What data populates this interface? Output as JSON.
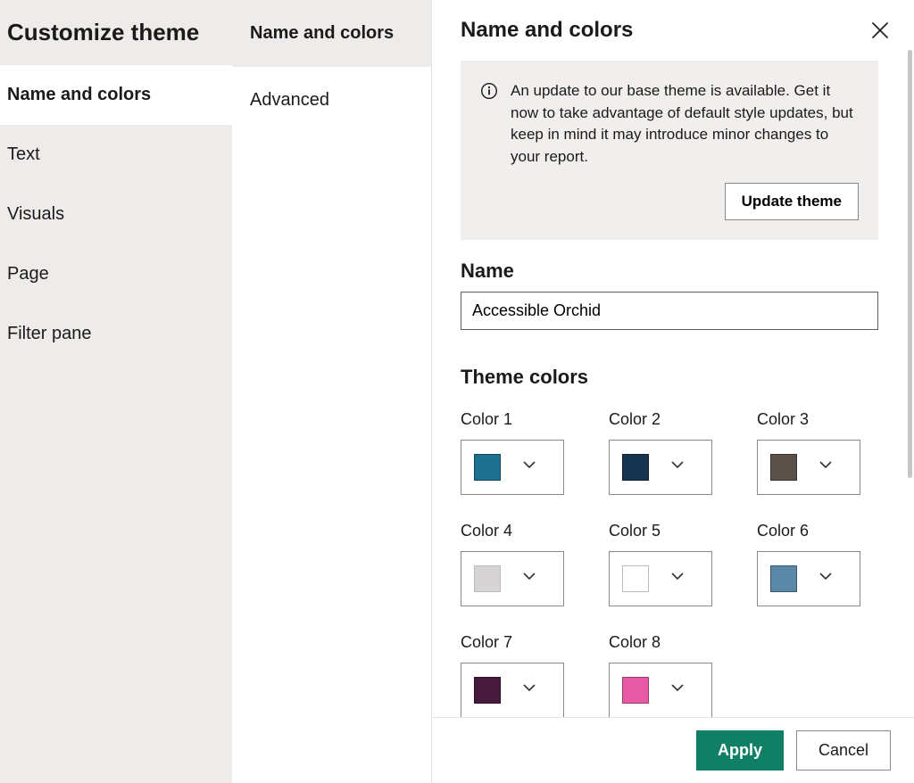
{
  "dialog_title": "Customize theme",
  "leftnav": {
    "items": [
      {
        "label": "Name and colors",
        "active": true
      },
      {
        "label": "Text",
        "active": false
      },
      {
        "label": "Visuals",
        "active": false
      },
      {
        "label": "Page",
        "active": false
      },
      {
        "label": "Filter pane",
        "active": false
      }
    ]
  },
  "subnav": {
    "items": [
      {
        "label": "Name and colors",
        "active": true
      },
      {
        "label": "Advanced",
        "active": false
      }
    ]
  },
  "main": {
    "title": "Name and colors",
    "banner": {
      "message": "An update to our base theme is available. Get it now to take advantage of default style updates, but keep in mind it may introduce minor changes to your report.",
      "action_label": "Update theme"
    },
    "name_section": {
      "label": "Name",
      "value": "Accessible Orchid"
    },
    "theme_colors": {
      "heading": "Theme colors",
      "slots": [
        {
          "label": "Color 1",
          "hex": "#1d6e8f"
        },
        {
          "label": "Color 2",
          "hex": "#16344f"
        },
        {
          "label": "Color 3",
          "hex": "#59514a"
        },
        {
          "label": "Color 4",
          "hex": "#d7d4d6"
        },
        {
          "label": "Color 5",
          "hex": "#ffffff"
        },
        {
          "label": "Color 6",
          "hex": "#5a89a8"
        },
        {
          "label": "Color 7",
          "hex": "#461a3d"
        },
        {
          "label": "Color 8",
          "hex": "#e75ba6"
        }
      ]
    }
  },
  "footer": {
    "apply": "Apply",
    "cancel": "Cancel"
  },
  "icons": {
    "close": "close-icon",
    "info": "info-icon",
    "chevron_down": "chevron-down-icon"
  }
}
